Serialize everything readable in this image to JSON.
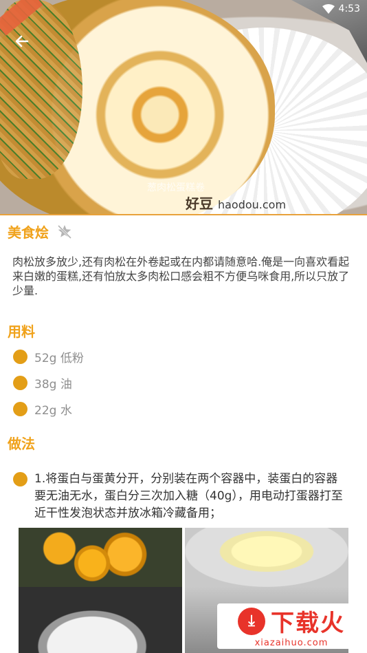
{
  "status_bar": {
    "time": "4:53"
  },
  "hero": {
    "caption": "葱肉松蛋糕卷",
    "watermark_brand": "好豆",
    "watermark_domain": "haodou.com"
  },
  "recipe": {
    "title": "美食烩",
    "description": "肉松放多放少,还有肉松在外卷起或在内都请随意哈.俺是一向喜欢看起来白嫩的蛋糕,还有怕放太多肉松口感会粗不方便乌咪食用,所以只放了少量.",
    "ingredients_heading": "用料",
    "ingredients": [
      "52g 低粉",
      "38g 油",
      "22g 水"
    ],
    "method_heading": "做法",
    "steps": [
      "1.将蛋白与蛋黄分开，分别装在两个容器中，装蛋白的容器要无油无水，蛋白分三次加入糖（40g），用电动打蛋器打至近干性发泡状态并放冰箱冷藏备用；"
    ]
  },
  "brand_logo": {
    "text": "下载火",
    "url": "xiazaihuo.com"
  },
  "colors": {
    "accent": "#f0a21b",
    "bullet": "#e39e17",
    "logo_red": "#e8332a"
  },
  "icons": {
    "back": "back-arrow-icon",
    "favorite": "favorite-off-icon",
    "wifi": "wifi-icon"
  }
}
